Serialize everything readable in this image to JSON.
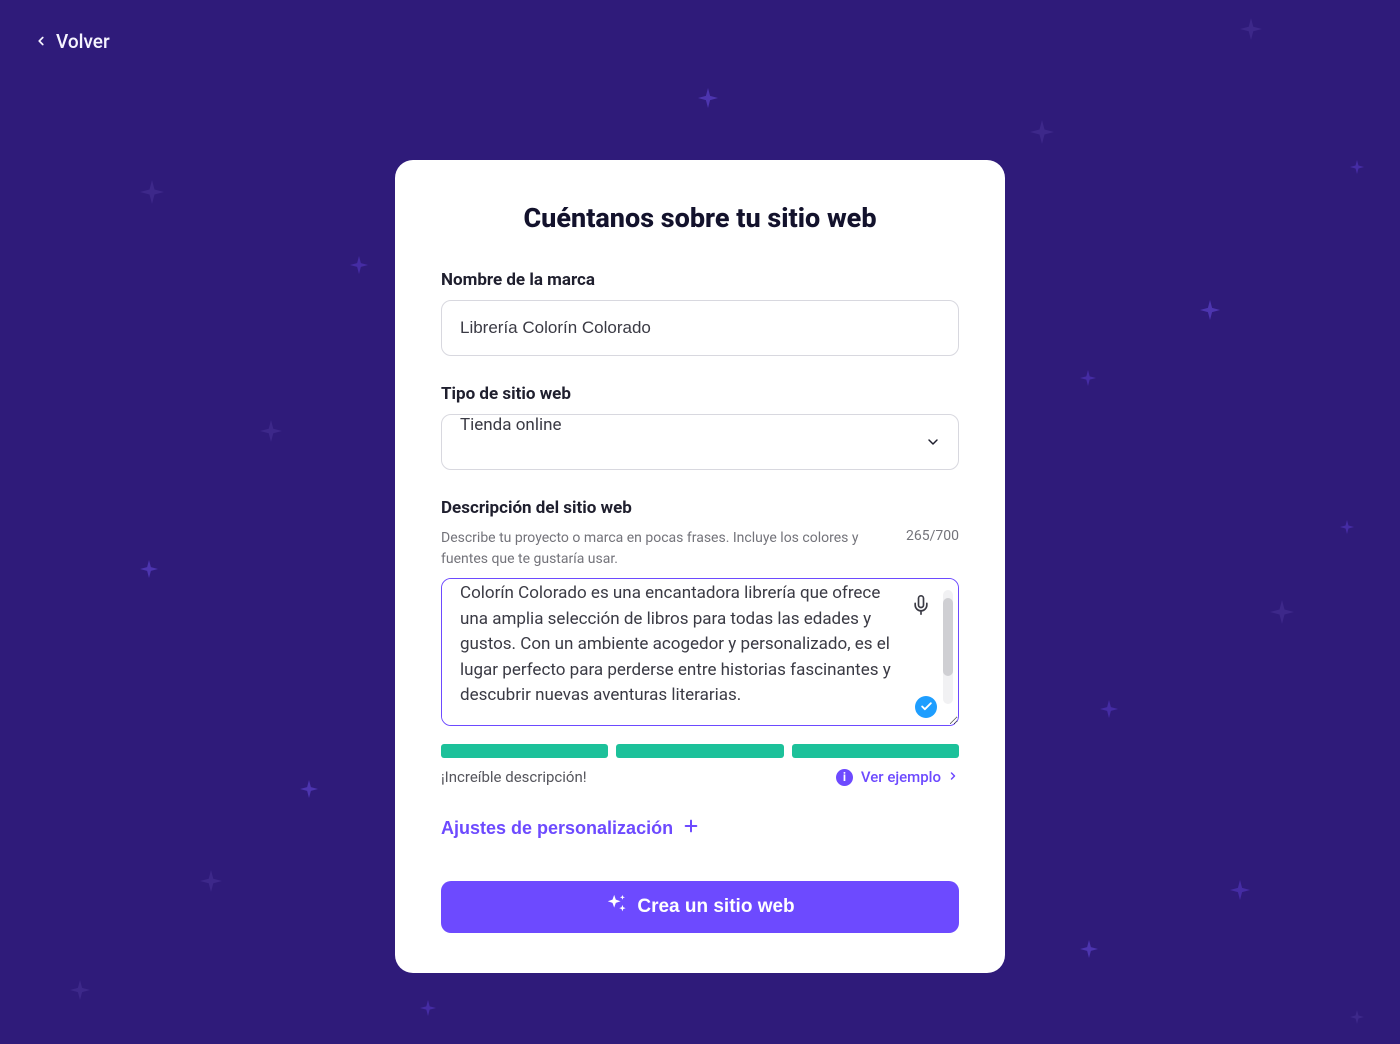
{
  "nav": {
    "back": "Volver"
  },
  "card": {
    "title": "Cuéntanos sobre tu sitio web",
    "brand": {
      "label": "Nombre de la marca",
      "value": "Librería Colorín Colorado"
    },
    "siteType": {
      "label": "Tipo de sitio web",
      "value": "Tienda online"
    },
    "description": {
      "label": "Descripción del sitio web",
      "helper": "Describe tu proyecto o marca en pocas frases. Incluye los colores y fuentes que te gustaría usar.",
      "counter": "265/700",
      "value": "Colorín Colorado es una encantadora librería que ofrece una amplia selección de libros para todas las edades y gustos. Con un ambiente acogedor y personalizado, es el lugar perfecto para perderse entre historias fascinantes y descubrir nuevas aventuras literarias.",
      "feedback": "¡Increíble descripción!",
      "example": "Ver ejemplo"
    },
    "personalization": "Ajustes de personalización",
    "cta": "Crea un sitio web"
  },
  "colors": {
    "accent": "#6d4aff",
    "bg": "#2f1b7a",
    "strength": "#1cc19a",
    "link": "#6d4aff"
  }
}
